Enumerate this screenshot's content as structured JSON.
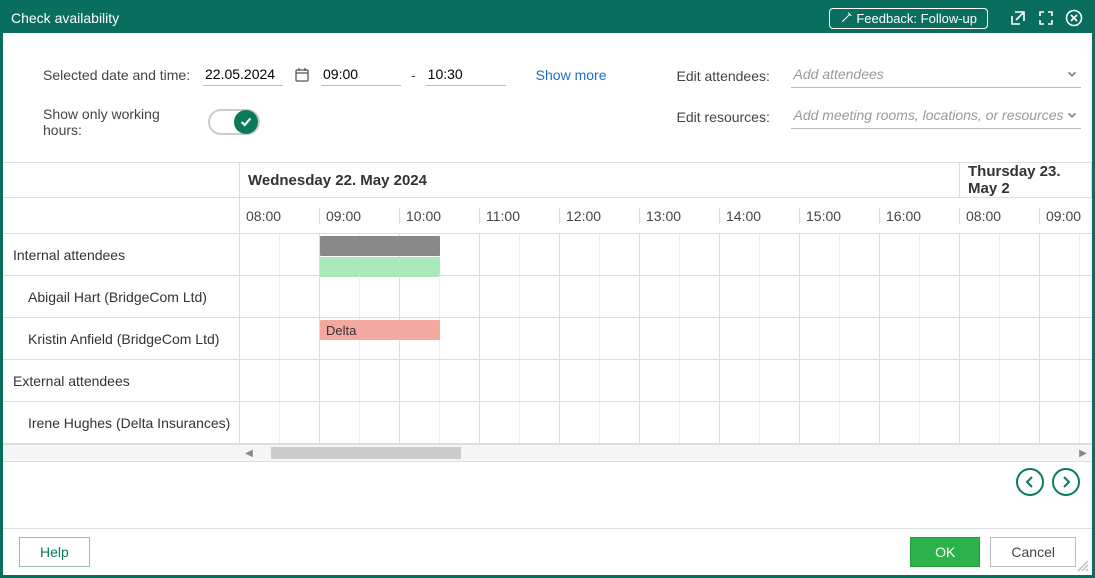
{
  "window_title": "Check availability",
  "titlebar": {
    "feedback_label": "Feedback: Follow-up"
  },
  "controls": {
    "date_label": "Selected date and time:",
    "date_value": "22.05.2024",
    "time_start": "09:00",
    "time_end": "10:30",
    "show_more": "Show more",
    "working_hours_label": "Show only working hours:",
    "working_hours_on": true,
    "edit_attendees_label": "Edit attendees:",
    "edit_attendees_placeholder": "Add attendees",
    "edit_resources_label": "Edit resources:",
    "edit_resources_placeholder": "Add meeting rooms, locations, or resources"
  },
  "calendar": {
    "day1_header": "Wednesday 22. May 2024",
    "day2_header": "Thursday 23. May 2",
    "hours_day1": [
      "08:00",
      "09:00",
      "10:00",
      "11:00",
      "12:00",
      "13:00",
      "14:00",
      "15:00",
      "16:00"
    ],
    "hours_day2": [
      "08:00",
      "09:00"
    ],
    "rows": [
      {
        "type": "group",
        "label": "Internal attendees",
        "events": [
          {
            "kind": "gray",
            "start_hour": 9.0,
            "end_hour": 10.5
          },
          {
            "kind": "stripes",
            "start_hour": 9.0,
            "end_hour": 10.5
          }
        ]
      },
      {
        "type": "person",
        "label": "Abigail Hart (BridgeCom Ltd)",
        "events": []
      },
      {
        "type": "person",
        "label": "Kristin Anfield (BridgeCom Ltd)",
        "events": [
          {
            "kind": "red",
            "label": "Delta",
            "start_hour": 9.0,
            "end_hour": 10.5
          }
        ]
      },
      {
        "type": "group",
        "label": "External attendees",
        "events": []
      },
      {
        "type": "person",
        "label": "Irene Hughes (Delta Insurances)",
        "events": []
      }
    ]
  },
  "footer": {
    "help": "Help",
    "ok": "OK",
    "cancel": "Cancel"
  }
}
